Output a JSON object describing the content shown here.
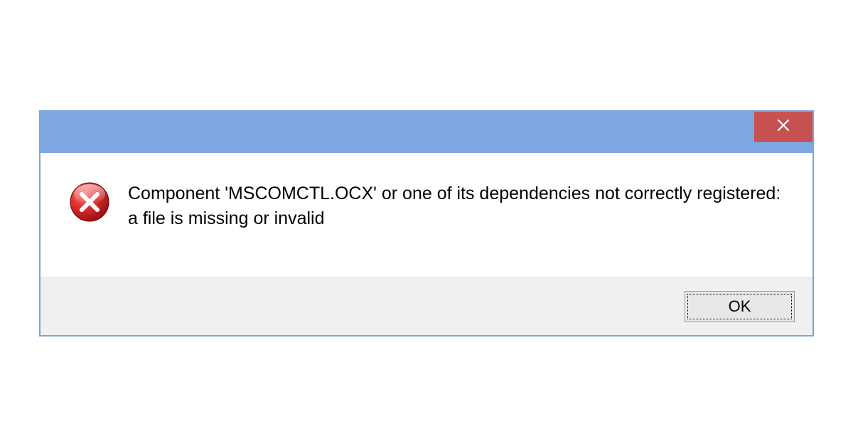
{
  "dialog": {
    "message": "Component 'MSCOMCTL.OCX' or one of its dependencies not correctly registered: a file is missing or invalid",
    "ok_label": "OK"
  },
  "icons": {
    "close": "close-icon",
    "error": "error-icon"
  },
  "colors": {
    "titlebar": "#7ea6e0",
    "close_button": "#c75050",
    "button_area": "#f0f0f0"
  }
}
